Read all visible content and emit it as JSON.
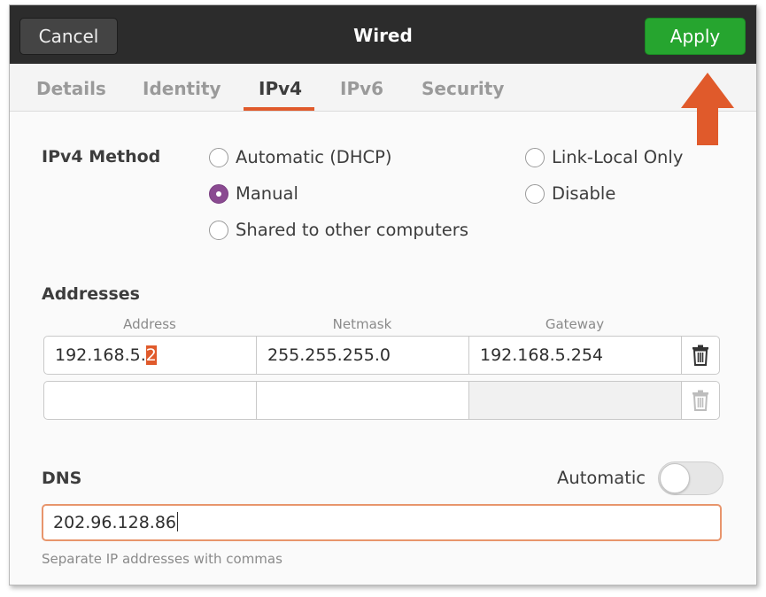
{
  "header": {
    "title": "Wired",
    "cancel_label": "Cancel",
    "apply_label": "Apply"
  },
  "tabs": [
    {
      "label": "Details"
    },
    {
      "label": "Identity"
    },
    {
      "label": "IPv4"
    },
    {
      "label": "IPv6"
    },
    {
      "label": "Security"
    }
  ],
  "active_tab": "IPv4",
  "ipv4_method": {
    "label": "IPv4 Method",
    "options": [
      {
        "label": "Automatic (DHCP)",
        "checked": false
      },
      {
        "label": "Manual",
        "checked": true
      },
      {
        "label": "Shared to other computers",
        "checked": false
      },
      {
        "label": "Link-Local Only",
        "checked": false
      },
      {
        "label": "Disable",
        "checked": false
      }
    ]
  },
  "addresses": {
    "label": "Addresses",
    "columns": [
      "Address",
      "Netmask",
      "Gateway"
    ],
    "rows": [
      {
        "address_prefix": "192.168.5.",
        "address_highlight": "2",
        "netmask": "255.255.255.0",
        "gateway": "192.168.5.254"
      },
      {
        "address_prefix": "",
        "address_highlight": "",
        "netmask": "",
        "gateway": ""
      }
    ]
  },
  "dns": {
    "label": "DNS",
    "automatic_label": "Automatic",
    "automatic_on": false,
    "value": "202.96.128.86",
    "hint": "Separate IP addresses with commas"
  },
  "colors": {
    "apply_green": "#26a52f",
    "accent_orange": "#e05a2b",
    "radio_checked": "#8a4a91",
    "header_bg": "#2c2c2c"
  },
  "icons": {
    "delete": "trash-icon",
    "annotation": "up-arrow-icon"
  }
}
